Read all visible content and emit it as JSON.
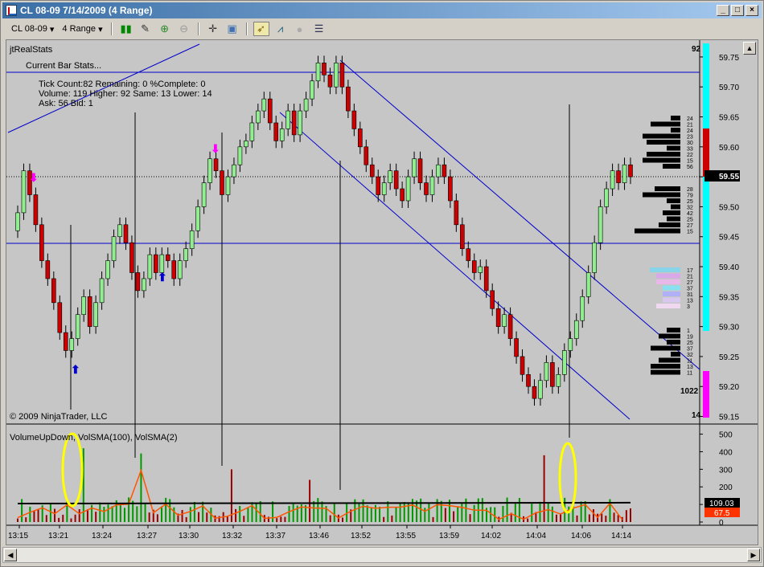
{
  "window": {
    "title": "CL 08-09  7/14/2009 (4 Range)",
    "minimize": "_",
    "maximize": "□",
    "close": "×"
  },
  "toolbar": {
    "instrument": "CL 08-09",
    "period": "4 Range"
  },
  "panel": {
    "indicator_label": "jtRealStats",
    "stats_title": "Current Bar Stats...",
    "line1": "Tick Count:82   Remaining: 0   %Complete: 0",
    "line2": "Volume: 119   Higher: 92   Same: 13   Lower: 14",
    "line3": "Ask: 56   Bid: 1",
    "copyright": "© 2009 NinjaTrader, LLC",
    "volume_label": "VolumeUpDown, VolSMA(100), VolSMA(2)"
  },
  "price_axis": {
    "labels": [
      "59.75",
      "59.70",
      "59.65",
      "59.60",
      "59.55",
      "59.50",
      "59.45",
      "59.40",
      "59.35",
      "59.30",
      "59.25",
      "59.20",
      "59.15"
    ],
    "current_price": "59.55",
    "top_count": "92",
    "mid_count": "1022",
    "bottom_count": "14"
  },
  "volume_axis": {
    "labels": [
      "500",
      "400",
      "300",
      "200",
      "100",
      "0"
    ],
    "sma100_value": "109.03",
    "sma2_value": "67.5"
  },
  "time_axis": {
    "labels": [
      "13:15",
      "13:21",
      "13:24",
      "13:27",
      "13:30",
      "13:32",
      "13:37",
      "13:46",
      "13:52",
      "13:55",
      "13:59",
      "14:02",
      "14:04",
      "14:06",
      "14:14"
    ]
  },
  "profile_numbers_top": [
    "24",
    "21",
    "24",
    "23",
    "30",
    "33",
    "22",
    "15",
    "56"
  ],
  "profile_numbers_mid": [
    "28",
    "79",
    "25",
    "32",
    "42",
    "25",
    "27",
    "15"
  ],
  "profile_numbers_lower": [
    "17",
    "21",
    "27",
    "37",
    "31",
    "13",
    "3"
  ],
  "profile_numbers_bottom": [
    "1",
    "19",
    "25",
    "37",
    "32",
    "11",
    "13",
    "11"
  ],
  "colors": {
    "up": "#90ee90",
    "down": "#cc0000",
    "background": "#c6c6c6",
    "trendline": "#0000cc",
    "highlight": "#ffff00",
    "cyan_bar": "#00ffff",
    "magenta_bar": "#ff00ff"
  },
  "chart_data": {
    "type": "candlestick",
    "title": "CL 08-09  7/14/2009 (4 Range)",
    "ylim": [
      59.14,
      59.77
    ],
    "closes": [
      59.49,
      59.56,
      59.52,
      59.47,
      59.41,
      59.38,
      59.34,
      59.29,
      59.26,
      59.28,
      59.32,
      59.35,
      59.3,
      59.34,
      59.38,
      59.41,
      59.45,
      59.47,
      59.44,
      59.39,
      59.36,
      59.38,
      59.42,
      59.39,
      59.42,
      59.41,
      59.38,
      59.41,
      59.43,
      59.46,
      59.5,
      59.54,
      59.58,
      59.56,
      59.52,
      59.55,
      59.57,
      59.6,
      59.61,
      59.64,
      59.66,
      59.68,
      59.64,
      59.61,
      59.63,
      59.66,
      59.62,
      59.66,
      59.68,
      59.71,
      59.74,
      59.72,
      59.7,
      59.74,
      59.7,
      59.66,
      59.63,
      59.6,
      59.57,
      59.55,
      59.52,
      59.54,
      59.56,
      59.53,
      59.51,
      59.55,
      59.58,
      59.54,
      59.52,
      59.55,
      59.57,
      59.55,
      59.51,
      59.47,
      59.43,
      59.41,
      59.39,
      59.4,
      59.36,
      59.33,
      59.3,
      59.32,
      59.28,
      59.25,
      59.22,
      59.2,
      59.18,
      59.21,
      59.24,
      59.2,
      59.22,
      59.26,
      59.28,
      59.31,
      59.35,
      59.39,
      59.44,
      59.5,
      59.53,
      59.56,
      59.54,
      59.57,
      59.55
    ]
  }
}
